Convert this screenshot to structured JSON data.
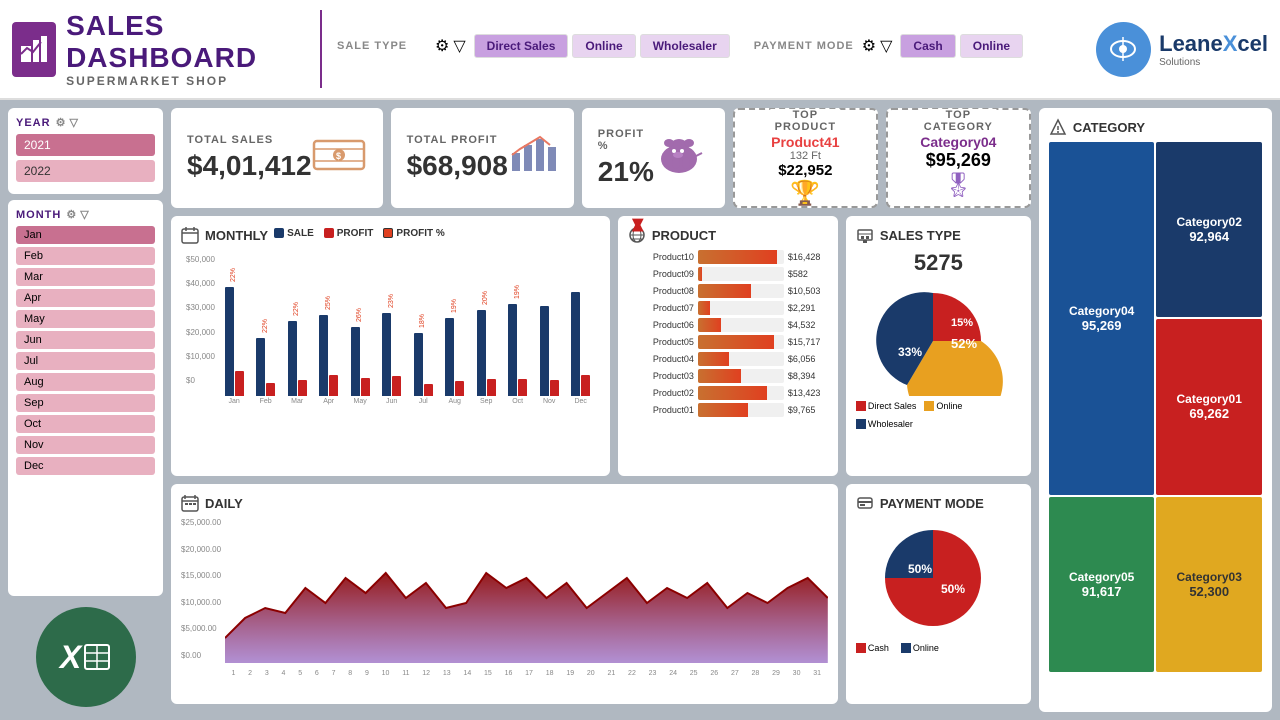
{
  "header": {
    "title": "SALES DASHBOARD",
    "subtitle": "SUPERMARKET SHOP",
    "brand": "LeaneXcel",
    "brand_sub": "Solutions"
  },
  "filters": {
    "sale_type_label": "SALE TYPE",
    "payment_mode_label": "PAYMENT MODE",
    "sale_types": [
      "Direct Sales",
      "Online",
      "Wholesaler"
    ],
    "payment_modes": [
      "Cash",
      "Online"
    ]
  },
  "years": {
    "label": "YEAR",
    "items": [
      "2021",
      "2022"
    ]
  },
  "months": {
    "label": "MONTH",
    "items": [
      "Jan",
      "Feb",
      "Mar",
      "Apr",
      "May",
      "Jun",
      "Jul",
      "Aug",
      "Sep",
      "Oct",
      "Nov",
      "Dec"
    ]
  },
  "kpis": {
    "total_sales_label": "TOTAL SALES",
    "total_sales_value": "$4,01,412",
    "total_profit_label": "TOTAL PROFIT",
    "total_profit_value": "$68,908",
    "profit_pct_label": "PROFIT %",
    "profit_pct_value": "21%"
  },
  "top_product": {
    "label": "TOP",
    "label2": "PRODUCT",
    "name": "Product41",
    "qty": "132  Ft",
    "price": "$22,952"
  },
  "top_category": {
    "label": "TOP",
    "label2": "CATEGORY",
    "name": "Category04",
    "price": "$95,269"
  },
  "monthly": {
    "title": "MONTHLY",
    "legend_sale": "SALE",
    "legend_profit": "PROFIT",
    "legend_pct": "PROFIT %",
    "months": [
      "Jan",
      "Feb",
      "Mar",
      "Apr",
      "May",
      "Jun",
      "Jul",
      "Aug",
      "Sep",
      "Oct",
      "Nov",
      "Dec"
    ],
    "pct_labels": [
      "22%",
      "22%",
      "22%",
      "25%",
      "26%",
      "23%",
      "18%",
      "19%",
      "20%",
      "19%",
      "",
      ""
    ],
    "bars": [
      {
        "sale": 95,
        "profit": 22,
        "pct": "22%"
      },
      {
        "sale": 50,
        "profit": 11,
        "pct": "22%"
      },
      {
        "sale": 65,
        "profit": 14,
        "pct": "22%"
      },
      {
        "sale": 70,
        "profit": 18,
        "pct": "25%"
      },
      {
        "sale": 60,
        "profit": 16,
        "pct": "26%"
      },
      {
        "sale": 72,
        "profit": 17,
        "pct": "23%"
      },
      {
        "sale": 55,
        "profit": 10,
        "pct": "18%"
      },
      {
        "sale": 68,
        "profit": 13,
        "pct": "19%"
      },
      {
        "sale": 75,
        "profit": 15,
        "pct": "20%"
      },
      {
        "sale": 80,
        "profit": 15,
        "pct": "19%"
      },
      {
        "sale": 78,
        "profit": 14,
        "pct": ""
      },
      {
        "sale": 90,
        "profit": 18,
        "pct": ""
      }
    ]
  },
  "products": {
    "title": "PRODUCT",
    "items": [
      {
        "name": "Product10",
        "value": "$16,428",
        "pct": 92
      },
      {
        "name": "Product09",
        "value": "$582",
        "pct": 5
      },
      {
        "name": "Product08",
        "value": "$10,503",
        "pct": 62
      },
      {
        "name": "Product07",
        "value": "$2,291",
        "pct": 14
      },
      {
        "name": "Product06",
        "value": "$4,532",
        "pct": 27
      },
      {
        "name": "Product05",
        "value": "$15,717",
        "pct": 88
      },
      {
        "name": "Product04",
        "value": "$6,056",
        "pct": 36
      },
      {
        "name": "Product03",
        "value": "$8,394",
        "pct": 50
      },
      {
        "name": "Product02",
        "value": "$13,423",
        "pct": 80
      },
      {
        "name": "Product01",
        "value": "$9,765",
        "pct": 58
      }
    ]
  },
  "sales_type": {
    "title": "SALES TYPE",
    "total": "5275",
    "segments": [
      {
        "label": "Direct Sales",
        "pct": 15,
        "color": "#c82020"
      },
      {
        "label": "Online",
        "pct": 52,
        "color": "#c87020"
      },
      {
        "label": "Wholesaler",
        "pct": 33,
        "color": "#1a3a6a"
      }
    ],
    "legend": [
      "Direct Sales",
      "Online",
      "Wholesaler"
    ]
  },
  "payment_mode": {
    "title": "PAYMENT MODE",
    "segments": [
      {
        "label": "Cash",
        "pct": 50,
        "color": "#c82020"
      },
      {
        "label": "Online",
        "pct": 50,
        "color": "#1a3a6a"
      }
    ],
    "cash_label": "Cash",
    "online_label": "Online",
    "cash_pct": "50%",
    "online_pct": "50%"
  },
  "daily": {
    "title": "DAILY",
    "y_labels": [
      "$25,000.00",
      "$20,000.00",
      "$15,000.00",
      "$10,000.00",
      "$5,000.00",
      "$0.00"
    ]
  },
  "category": {
    "title": "CATEGORY",
    "items": [
      {
        "name": "Category04",
        "value": "95,269",
        "color": "blue"
      },
      {
        "name": "Category02",
        "value": "92,964",
        "color": "navy"
      },
      {
        "name": "Category05",
        "value": "91,617",
        "color": "green"
      },
      {
        "name": "Category03",
        "value": "52,300",
        "color": "yellow"
      },
      {
        "name": "Category01",
        "value": "69,262",
        "color": "red"
      }
    ]
  }
}
